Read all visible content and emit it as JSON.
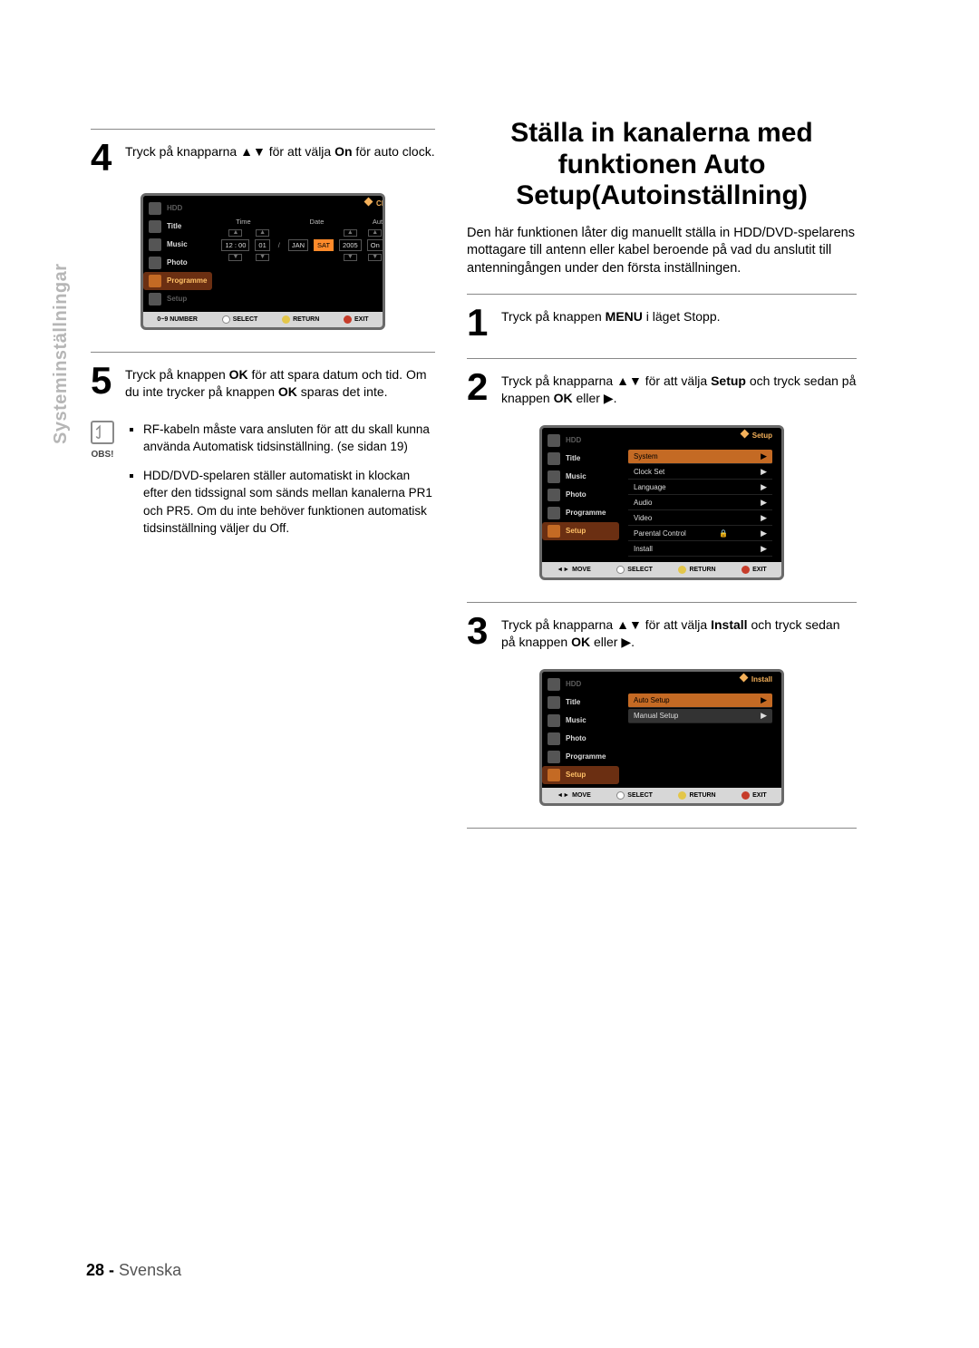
{
  "sidebar_label": "Systeminställningar",
  "footer": {
    "page": "28 -",
    "lang": "Svenska"
  },
  "left": {
    "step4": {
      "num": "4",
      "pre": "Tryck på knapparna ",
      "sym": "▲▼ ",
      "mid": "för att välja ",
      "opt": "On",
      "post": " för auto clock."
    },
    "step5": {
      "num": "5",
      "l1_pre": "Tryck på knappen ",
      "l1_b": "OK",
      "l1_post": " för att spara datum och tid.",
      "l2_pre": "Om du inte trycker på knappen ",
      "l2_b": "OK",
      "l2_post": " sparas det inte."
    },
    "obs_label": "OBS!",
    "notes": [
      "RF-kabeln måste vara ansluten för att du skall kunna använda Automatisk tidsinställning. (se sidan 19)",
      "HDD/DVD-spelaren ställer automatiskt in klockan efter den tidssignal som sänds mellan kanalerna PR1 och PR5. Om du inte behöver funktionen automatisk tidsinställning väljer du Off."
    ]
  },
  "right": {
    "title": "Ställa in kanalerna med funktionen Auto Setup(Autoinställning)",
    "intro": "Den här funktionen låter dig manuellt ställa in HDD/DVD-spelarens mottagare till antenn eller kabel beroende på vad du anslutit till antenningången under den första inställningen.",
    "step1": {
      "num": "1",
      "pre": "Tryck på knappen ",
      "b": "MENU",
      "post": " i läget Stopp."
    },
    "step2": {
      "num": "2",
      "pre": "Tryck på knapparna ",
      "sym": "▲▼ ",
      "mid": "för att välja ",
      "b": "Setup",
      "post": " och tryck sedan på knappen ",
      "b2": "OK",
      "tail": " eller ▶."
    },
    "step3": {
      "num": "3",
      "pre": "Tryck på knapparna ",
      "sym": "▲▼ ",
      "mid": "för att välja ",
      "b": "Install",
      "post": " och tryck sedan på knappen ",
      "b2": "OK",
      "tail": " eller ▶."
    }
  },
  "osd": {
    "side": [
      {
        "label": "HDD",
        "dim": true
      },
      {
        "label": "Title"
      },
      {
        "label": "Music"
      },
      {
        "label": "Photo"
      },
      {
        "label": "Programme",
        "hl": true
      },
      {
        "label": "Setup",
        "dim": true
      }
    ],
    "side_setup": [
      {
        "label": "HDD",
        "dim": true
      },
      {
        "label": "Title"
      },
      {
        "label": "Music"
      },
      {
        "label": "Photo"
      },
      {
        "label": "Programme"
      },
      {
        "label": "Setup",
        "hl": true
      }
    ],
    "foot_clock": [
      "0~9 NUMBER",
      "SELECT",
      "RETURN",
      "EXIT"
    ],
    "foot_menu": [
      "MOVE",
      "SELECT",
      "RETURN",
      "EXIT"
    ],
    "clock": {
      "caption": "Clock Set",
      "headers": [
        "Time",
        "Date",
        "Auto Clock"
      ],
      "time": "12 : 00",
      "day": "01",
      "mon": "JAN",
      "dow": "SAT",
      "year": "2005",
      "auto": "On"
    },
    "setup_menu": {
      "caption": "Setup",
      "items": [
        "System",
        "Clock Set",
        "Language",
        "Audio",
        "Video",
        "Parental Control",
        "Install"
      ],
      "selected": 0,
      "locked_idx": 5
    },
    "install_menu": {
      "caption": "Install",
      "items": [
        "Auto Setup",
        "Manual Setup"
      ],
      "selected": 0
    }
  }
}
